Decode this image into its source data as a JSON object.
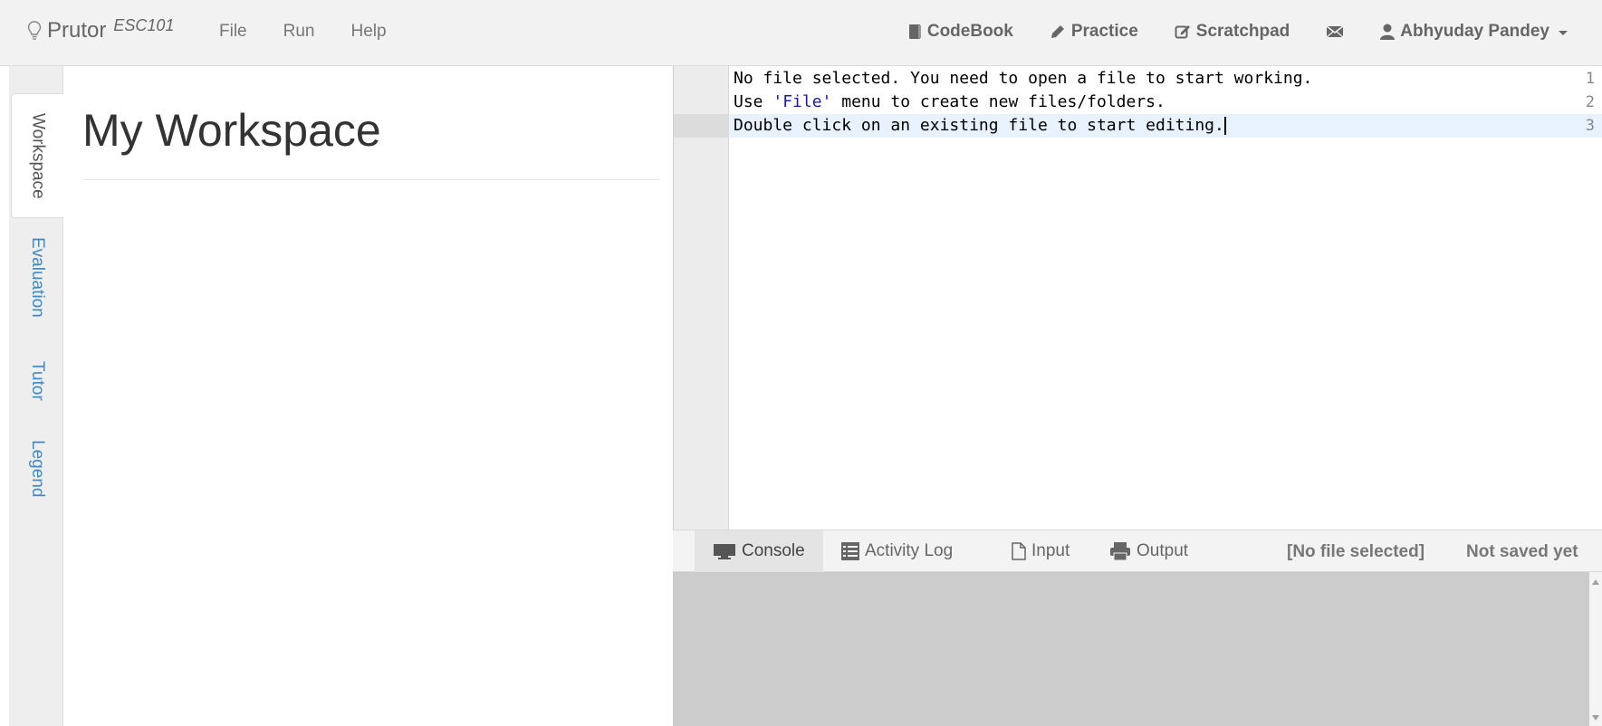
{
  "brand": {
    "name": "Prutor",
    "course": "ESC101"
  },
  "nav": {
    "left": [
      "File",
      "Run",
      "Help"
    ],
    "codebook": "CodeBook",
    "practice": "Practice",
    "scratchpad": "Scratchpad",
    "user": "Abhyuday Pandey"
  },
  "sidebar": {
    "tabs": [
      "Workspace",
      "Evaluation",
      "Tutor",
      "Legend"
    ],
    "active": "Workspace"
  },
  "workspace": {
    "title": "My Workspace"
  },
  "editor": {
    "line_numbers": [
      "1",
      "2",
      "3"
    ],
    "line1": "No file selected. You need to open a file to start working.",
    "line2_pre": "Use ",
    "line2_str": "'File'",
    "line2_post": " menu to create new files/folders.",
    "line3": "Double click on an existing file to start editing.",
    "active_line": 3
  },
  "bottom": {
    "tabs": [
      "Console",
      "Activity Log",
      "Input",
      "Output"
    ],
    "active": "Console",
    "file_status": "[No file selected]",
    "save_status": "Not saved yet"
  },
  "colors": {
    "link": "#3e8ac6",
    "string": "#1a1aa6",
    "console_bg": "#cccccc"
  }
}
